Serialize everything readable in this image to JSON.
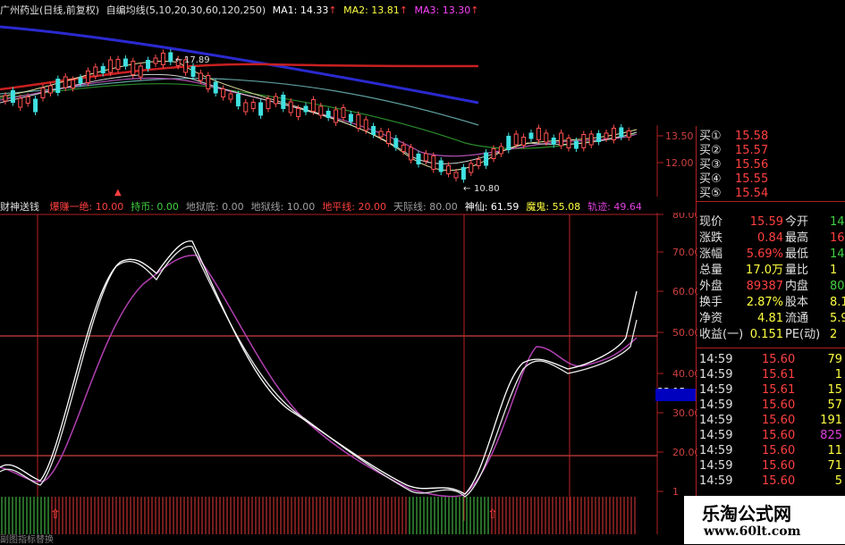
{
  "header": {
    "title": "广州药业(日线,前复权)",
    "ma_group": "自编均线(5,10,20,30,60,120,250)",
    "ma1": "MA1: 14.33",
    "ma2": "MA2: 13.81",
    "ma3": "MA3: 13.30",
    "arrow": "↑"
  },
  "main_chart": {
    "annot_high": "17.89",
    "annot_low": "10.80",
    "y_axis": [
      "13.50",
      "12.00"
    ]
  },
  "indicator_header": {
    "name": "财神送钱",
    "items": [
      {
        "text": "爆赚一绝: 10.00",
        "color": "#ff4040"
      },
      {
        "text": "持币: 0.00",
        "color": "#40d040"
      },
      {
        "text": "地狱底: 0.00",
        "color": "#a0a0a0"
      },
      {
        "text": "地狱线: 10.00",
        "color": "#a0a0a0"
      },
      {
        "text": "地平线: 20.00",
        "color": "#ff4040"
      },
      {
        "text": "天际线: 80.00",
        "color": "#a0a0a0"
      },
      {
        "text": "神仙: 61.59",
        "color": "#ffffff"
      },
      {
        "text": "魔鬼: 55.08",
        "color": "#ffff40"
      },
      {
        "text": "轨迹: 49.64",
        "color": "#e040e0"
      }
    ]
  },
  "indicator_axis": [
    "80.00",
    "70.00",
    "60.00",
    "50.00",
    "40.00",
    "33.15",
    "30.00",
    "20.00",
    "1"
  ],
  "bottom_label": "副图指标替换",
  "quotes": {
    "bids": [
      {
        "label": "买①",
        "price": "15.58"
      },
      {
        "label": "买②",
        "price": "15.57"
      },
      {
        "label": "买③",
        "price": "15.56"
      },
      {
        "label": "买④",
        "price": "15.55"
      },
      {
        "label": "买⑤",
        "price": "15.54"
      }
    ],
    "stats": [
      {
        "l1": "现价",
        "v1": "15.59",
        "c1": "#ff4040",
        "l2": "今开",
        "v2": "14",
        "c2": "#40d040"
      },
      {
        "l1": "涨跌",
        "v1": "0.84",
        "c1": "#ff4040",
        "l2": "最高",
        "v2": "16",
        "c2": "#ff4040"
      },
      {
        "l1": "涨幅",
        "v1": "5.69%",
        "c1": "#ff4040",
        "l2": "最低",
        "v2": "14",
        "c2": "#40d040"
      },
      {
        "l1": "总量",
        "v1": "17.0万",
        "c1": "#ffff40",
        "l2": "量比",
        "v2": "1",
        "c2": "#ffff40"
      },
      {
        "l1": "外盘",
        "v1": "89387",
        "c1": "#ff4040",
        "l2": "内盘",
        "v2": "80",
        "c2": "#40d040"
      },
      {
        "l1": "换手",
        "v1": "2.87%",
        "c1": "#ffff40",
        "l2": "股本",
        "v2": "8.1",
        "c2": "#ffff40"
      },
      {
        "l1": "净资",
        "v1": "4.81",
        "c1": "#ffff40",
        "l2": "流通",
        "v2": "5.9",
        "c2": "#ffff40"
      },
      {
        "l1": "收益(一)",
        "v1": "0.151",
        "c1": "#ffff40",
        "l2": "PE(动)",
        "v2": "2",
        "c2": "#ffff40"
      }
    ],
    "ticks": [
      {
        "t": "14:59",
        "p": "15.60",
        "v": "79",
        "vc": "#ffff40"
      },
      {
        "t": "14:59",
        "p": "15.61",
        "v": "1",
        "vc": "#ffff40"
      },
      {
        "t": "14:59",
        "p": "15.61",
        "v": "15",
        "vc": "#ffff40"
      },
      {
        "t": "14:59",
        "p": "15.60",
        "v": "57",
        "vc": "#ffff40"
      },
      {
        "t": "14:59",
        "p": "15.60",
        "v": "191",
        "vc": "#ffff40"
      },
      {
        "t": "14:59",
        "p": "15.60",
        "v": "825",
        "vc": "#e040e0"
      },
      {
        "t": "14:59",
        "p": "15.60",
        "v": "11",
        "vc": "#ffff40"
      },
      {
        "t": "14:59",
        "p": "15.60",
        "v": "71",
        "vc": "#ffff40"
      },
      {
        "t": "14:59",
        "p": "15.60",
        "v": "5",
        "vc": "#ffff40"
      }
    ]
  },
  "watermark": {
    "title": "乐淘公式网",
    "url": "www.60lt.com"
  },
  "colors": {
    "up": "#ff4040",
    "down": "#40e0e0",
    "grid": "#b02020",
    "ma_blue": "#2020c0",
    "ma_red": "#c02020"
  }
}
